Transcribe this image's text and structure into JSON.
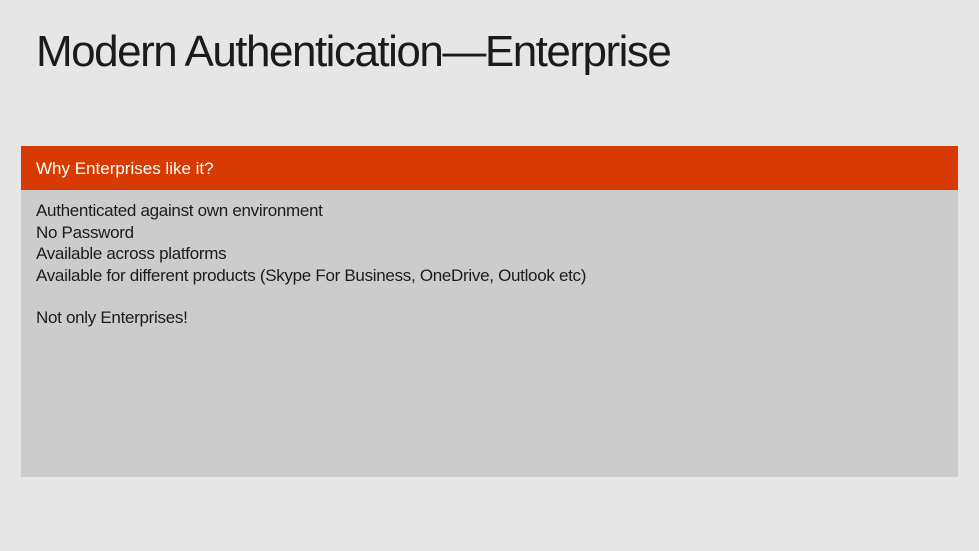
{
  "slide": {
    "title": "Modern Authentication—Enterprise",
    "panel": {
      "header": "Why Enterprises like it?",
      "bullets": [
        "Authenticated against own environment",
        "No Password",
        "Available across platforms",
        "Available for different products (Skype For Business, OneDrive, Outlook etc)"
      ],
      "note": "Not only Enterprises!"
    }
  },
  "colors": {
    "background": "#e6e6e6",
    "header_accent": "#d83b01",
    "panel_body": "#cccccc",
    "text": "#1b1b1b"
  }
}
